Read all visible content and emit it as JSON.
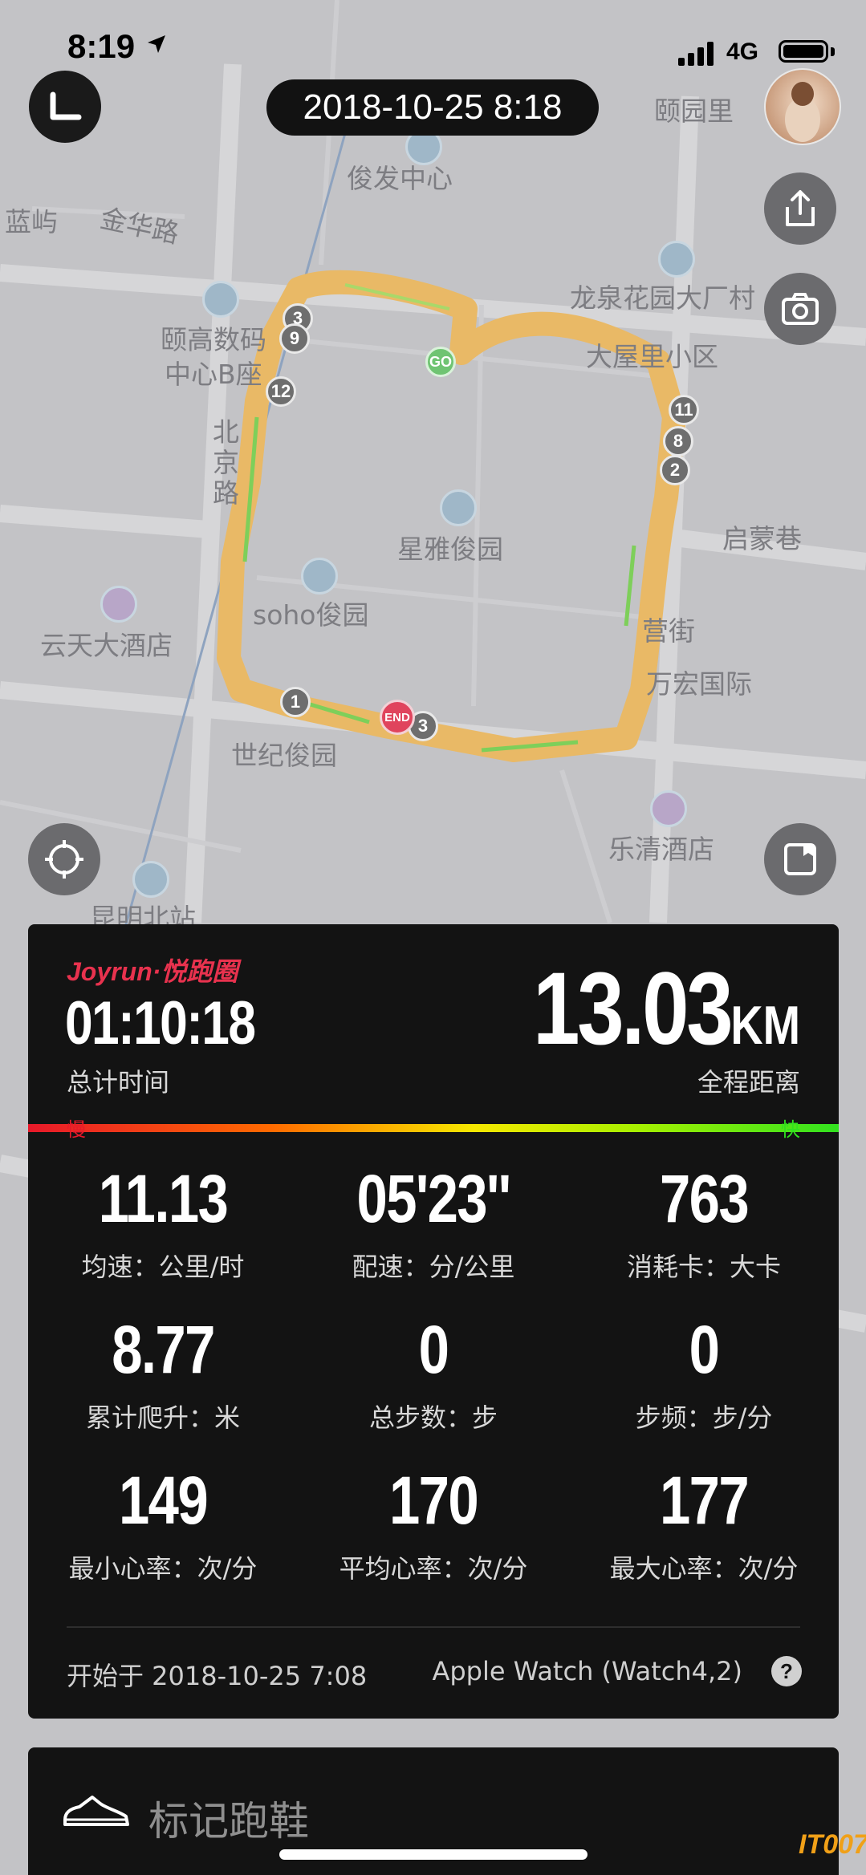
{
  "status_bar": {
    "time": "8:19",
    "network": "4G"
  },
  "header": {
    "date_time": "2018-10-25 8:18"
  },
  "map": {
    "labels": {
      "junfa": "俊发中心",
      "lanyu": "蓝屿",
      "jinhualu": "金华路",
      "yiyuanli": "颐园里",
      "longquan": "龙泉花园大厂村",
      "yigao1": "颐高数码",
      "yigao2": "中心B座",
      "beijinglu": "北京路",
      "xiaoqu": "大屋里小区",
      "xingya": "星雅俊园",
      "qimeng": "启蒙巷",
      "soho": "soho俊园",
      "yuntian": "云天大酒店",
      "yingjie": "营街",
      "wanhong": "万宏国际",
      "shiji": "世纪俊园",
      "leqing": "乐清酒店",
      "station": "昆明北站"
    },
    "markers": [
      "3",
      "9",
      "12",
      "11",
      "8",
      "2",
      "1",
      "3"
    ],
    "start_marker": "GO",
    "end_marker": "END"
  },
  "summary": {
    "brand": "Joyrun·悦跑圈",
    "total_time": "01:10:18",
    "total_time_label": "总计时间",
    "distance": "13.03",
    "distance_unit": "KM",
    "distance_label": "全程距离",
    "slow_label": "慢",
    "fast_label": "快"
  },
  "stats": [
    {
      "value": "11.13",
      "label": "均速：公里/时"
    },
    {
      "value": "05'23''",
      "label": "配速：分/公里"
    },
    {
      "value": "763",
      "label": "消耗卡：大卡"
    },
    {
      "value": "8.77",
      "label": "累计爬升：米"
    },
    {
      "value": "0",
      "label": "总步数：步"
    },
    {
      "value": "0",
      "label": "步频：步/分"
    },
    {
      "value": "149",
      "label": "最小心率：次/分"
    },
    {
      "value": "170",
      "label": "平均心率：次/分"
    },
    {
      "value": "177",
      "label": "最大心率：次/分"
    }
  ],
  "footer": {
    "start_time": "开始于 2018-10-25 7:08",
    "device": "Apple Watch (Watch4,2)",
    "help": "?"
  },
  "shoe": {
    "label": "标记跑鞋"
  },
  "watermark": "IT007",
  "colors": {
    "route": "#e9b966",
    "brand": "#e8324e",
    "card_bg": "#131313"
  }
}
